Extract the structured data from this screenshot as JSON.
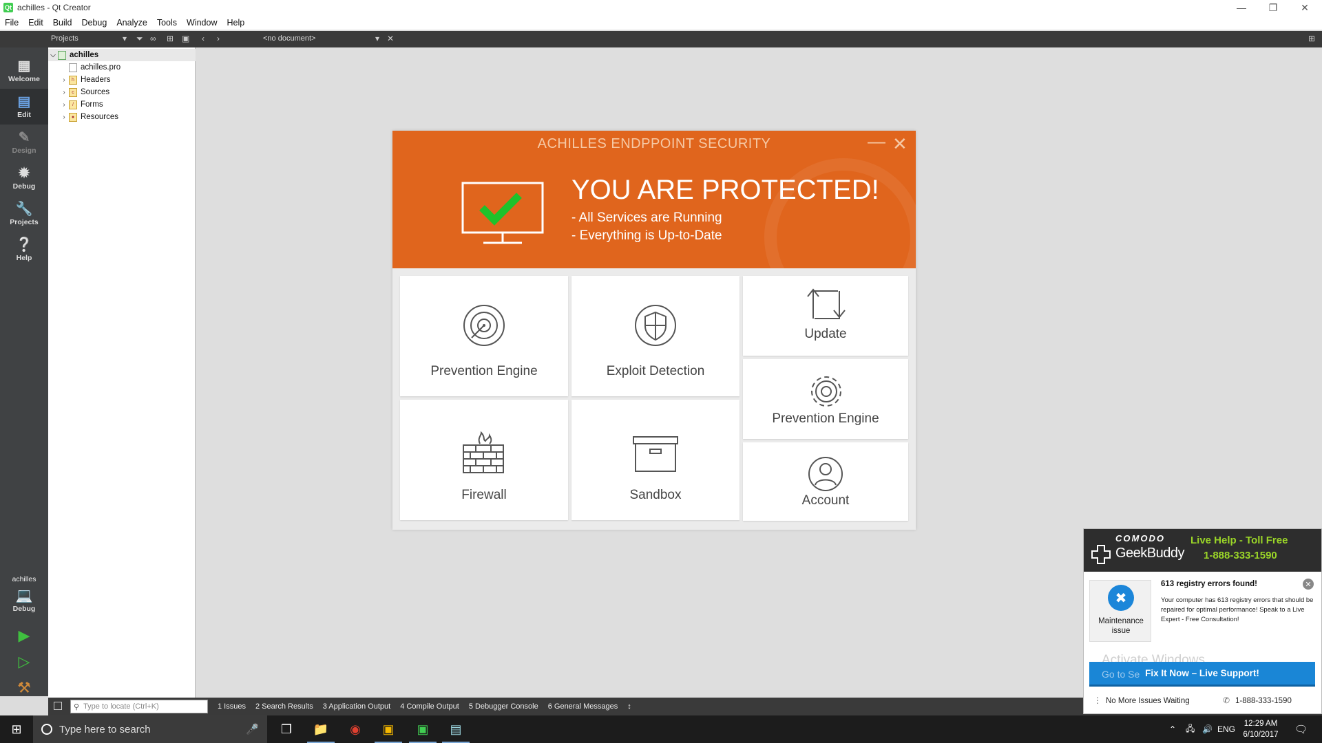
{
  "window": {
    "title": "achilles - Qt Creator"
  },
  "menu": [
    "File",
    "Edit",
    "Build",
    "Debug",
    "Analyze",
    "Tools",
    "Window",
    "Help"
  ],
  "toolbar": {
    "projects_label": "Projects",
    "document_selector": "<no document>"
  },
  "modes": [
    {
      "label": "Welcome",
      "icon": "grid-icon"
    },
    {
      "label": "Edit",
      "icon": "edit-icon"
    },
    {
      "label": "Design",
      "icon": "pencil-icon"
    },
    {
      "label": "Debug",
      "icon": "bug-icon"
    },
    {
      "label": "Projects",
      "icon": "wrench-icon"
    },
    {
      "label": "Help",
      "icon": "help-icon"
    }
  ],
  "kit": {
    "project": "achilles",
    "config": "Debug"
  },
  "tree": {
    "root": "achilles",
    "items": [
      "achilles.pro",
      "Headers",
      "Sources",
      "Forms",
      "Resources"
    ]
  },
  "output_bar": {
    "locate_placeholder": "Type to locate (Ctrl+K)",
    "tabs": [
      "1  Issues",
      "2  Search Results",
      "3  Application Output",
      "4  Compile Output",
      "5  Debugger Console",
      "6  General Messages"
    ]
  },
  "achilles": {
    "title": "ACHILLES ENDPPOINT SECURITY",
    "headline": "YOU ARE PROTECTED!",
    "lines": [
      "- All Services are Running",
      "- Everything is Up-to-Date"
    ],
    "accent": "#e0651d",
    "tiles": {
      "prevention_engine": "Prevention Engine",
      "exploit_detection": "Exploit Detection",
      "update": "Update",
      "prevention_engine_2": "Prevention Engine",
      "firewall": "Firewall",
      "sandbox": "Sandbox",
      "account": "Account"
    }
  },
  "geekbuddy": {
    "brand_top": "COMODO",
    "brand_name": "GeekBuddy",
    "live_help": "Live Help - Toll Free",
    "live_phone": "1-888-333-1590",
    "tile_label": "Maintenance issue",
    "error_title": "613 registry errors found!",
    "error_body": "Your computer has 613 registry errors that should be repaired for optimal performance! Speak to a Live Expert -  Free Consultation!",
    "watermark_1": "Activate Windows",
    "watermark_2": "Go to Se",
    "fix_button": "Fix It Now – Live Support!",
    "footer_status": "No More Issues Waiting",
    "footer_phone": "1-888-333-1590"
  },
  "taskbar": {
    "search_placeholder": "Type here to search",
    "language": "ENG",
    "time": "12:29 AM",
    "date": "6/10/2017"
  }
}
